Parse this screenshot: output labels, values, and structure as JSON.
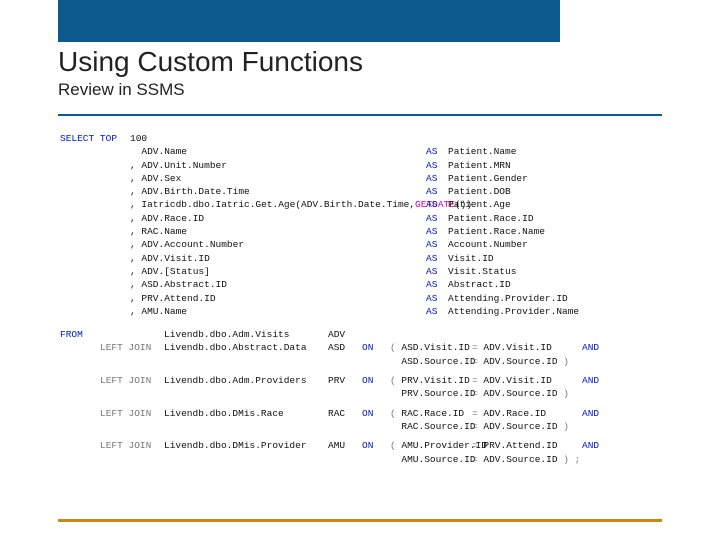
{
  "header": {
    "title": "Using Custom Functions",
    "subtitle": "Review in SSMS"
  },
  "sql": {
    "select": "SELECT",
    "top": "TOP",
    "topN": "100",
    "as": "AS",
    "from": "FROM",
    "left": "LEFT",
    "join": "JOIN",
    "on": "ON",
    "and": "AND",
    "getdate": "GETDATE",
    "columns": [
      {
        "expr": "  ADV.Name",
        "alias": "Patient.Name"
      },
      {
        "expr": ", ADV.Unit.Number",
        "alias": "Patient.MRN"
      },
      {
        "expr": ", ADV.Sex",
        "alias": "Patient.Gender"
      },
      {
        "expr": ", ADV.Birth.Date.Time",
        "alias": "Patient.DOB"
      },
      {
        "expr": ", Iatricdb.dbo.Iatric.Get.Age(ADV.Birth.Date.Time,",
        "alias": "Patient.Age",
        "hasFunc": true,
        "tail": "())"
      },
      {
        "expr": ", ADV.Race.ID",
        "alias": "Patient.Race.ID"
      },
      {
        "expr": ", RAC.Name",
        "alias": "Patient.Race.Name"
      },
      {
        "expr": ", ADV.Account.Number",
        "alias": "Account.Number"
      },
      {
        "expr": ", ADV.Visit.ID",
        "alias": "Visit.ID"
      },
      {
        "expr": ", ADV.[Status]",
        "alias": "Visit.Status"
      },
      {
        "expr": ", ASD.Abstract.ID",
        "alias": "Abstract.ID"
      },
      {
        "expr": ", PRV.Attend.ID",
        "alias": "Attending.Provider.ID"
      },
      {
        "expr": ", AMU.Name",
        "alias": "Attending.Provider.Name"
      }
    ],
    "joins": [
      {
        "type": "from",
        "table": "Livendb.dbo.Adm.Visits",
        "alias": "ADV"
      },
      {
        "type": "left",
        "table": "Livendb.dbo.Abstract.Data",
        "alias": "ASD",
        "on": [
          {
            "l": "ASD.Visit.ID",
            "r": "ADV.Visit.ID",
            "open": true,
            "close": false,
            "and": true
          },
          {
            "l": "ASD.Source.ID",
            "r": "ADV.Source.ID",
            "open": false,
            "close": true,
            "and": false
          }
        ]
      },
      {
        "type": "left",
        "table": "Livendb.dbo.Adm.Providers",
        "alias": "PRV",
        "on": [
          {
            "l": "PRV.Visit.ID",
            "r": "ADV.Visit.ID",
            "open": true,
            "close": false,
            "and": true
          },
          {
            "l": "PRV.Source.ID",
            "r": "ADV.Source.ID",
            "open": false,
            "close": true,
            "and": false
          }
        ]
      },
      {
        "type": "left",
        "table": "Livendb.dbo.DMis.Race",
        "alias": "RAC",
        "on": [
          {
            "l": "RAC.Race.ID",
            "r": "ADV.Race.ID",
            "open": true,
            "close": false,
            "and": true
          },
          {
            "l": "RAC.Source.ID",
            "r": "ADV.Source.ID",
            "open": false,
            "close": true,
            "and": false
          }
        ]
      },
      {
        "type": "left",
        "table": "Livendb.dbo.DMis.Provider",
        "alias": "AMU",
        "on": [
          {
            "l": "AMU.Provider.ID",
            "r": "PRV.Attend.ID",
            "open": true,
            "close": false,
            "and": true
          },
          {
            "l": "AMU.Source.ID",
            "r": "ADV.Source.ID",
            "open": false,
            "close": true,
            "and": false,
            "semi": true
          }
        ]
      }
    ]
  }
}
